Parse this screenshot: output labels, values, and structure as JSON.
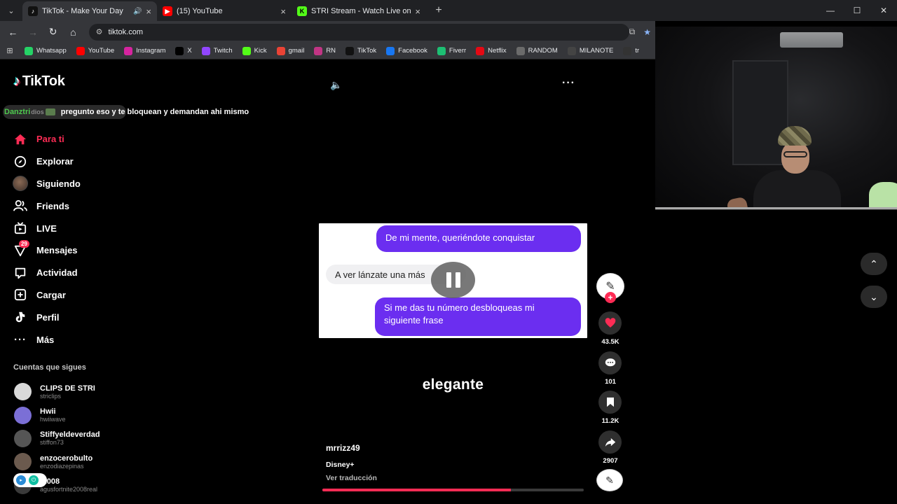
{
  "browser": {
    "tabs": [
      {
        "title": "TikTok - Make Your Day",
        "active": true,
        "favicon": "tiktok-icon",
        "audio": true
      },
      {
        "title": "(15) YouTube",
        "active": false,
        "favicon": "youtube-icon"
      },
      {
        "title": "STRI Stream - Watch Live on Ki",
        "active": false,
        "favicon": "kick-icon"
      }
    ],
    "url": "tiktok.com",
    "bookmarks": [
      {
        "label": "Whatsapp",
        "icon": "whatsapp-icon",
        "color": "#25d366"
      },
      {
        "label": "YouTube",
        "icon": "youtube-icon",
        "color": "#ff0000"
      },
      {
        "label": "Instagram",
        "icon": "instagram-icon",
        "color": "#d6249f"
      },
      {
        "label": "X",
        "icon": "x-icon",
        "color": "#000000"
      },
      {
        "label": "Twitch",
        "icon": "twitch-icon",
        "color": "#9146ff"
      },
      {
        "label": "Kick",
        "icon": "kick-icon",
        "color": "#53fc18"
      },
      {
        "label": "gmail",
        "icon": "gmail-icon",
        "color": "#ea4335"
      },
      {
        "label": "RN",
        "icon": "rn-icon",
        "color": "#c13584"
      },
      {
        "label": "TikTok",
        "icon": "tiktok-icon",
        "color": "#111111"
      },
      {
        "label": "Facebook",
        "icon": "facebook-icon",
        "color": "#1877f2"
      },
      {
        "label": "Fiverr",
        "icon": "fiverr-icon",
        "color": "#1dbf73"
      },
      {
        "label": "Netflix",
        "icon": "netflix-icon",
        "color": "#e50914"
      },
      {
        "label": "RANDOM",
        "icon": "random-icon",
        "color": "#6b6b6b"
      },
      {
        "label": "MILANOTE",
        "icon": "milanote-icon",
        "color": "#444444"
      },
      {
        "label": "tr",
        "icon": "tr-icon",
        "color": "#333333"
      }
    ]
  },
  "overlay_chat": {
    "user": "Danztri",
    "user_suffix": "dios",
    "message": "pregunto eso y te bloquean y demandan ahi mismo"
  },
  "tiktok": {
    "logo_text": "TikTok",
    "nav": [
      {
        "label": "Para ti",
        "icon": "home-icon",
        "active": true
      },
      {
        "label": "Explorar",
        "icon": "compass-icon"
      },
      {
        "label": "Siguiendo",
        "icon": "avatar"
      },
      {
        "label": "Friends",
        "icon": "friends-icon"
      },
      {
        "label": "LIVE",
        "icon": "live-icon"
      },
      {
        "label": "Mensajes",
        "icon": "messages-icon",
        "badge": "29"
      },
      {
        "label": "Actividad",
        "icon": "activity-icon"
      },
      {
        "label": "Cargar",
        "icon": "upload-icon"
      },
      {
        "label": "Perfil",
        "icon": "profile-icon"
      },
      {
        "label": "Más",
        "icon": "more-icon"
      }
    ],
    "following_title": "Cuentas que sigues",
    "following": [
      {
        "name": "CLIPS DE STRI",
        "handle": "striclips",
        "color": "#d9d9d9"
      },
      {
        "name": "Hwii",
        "handle": "hwiiwave",
        "color": "#7b6fd6"
      },
      {
        "name": "Stiffyeldeverdad",
        "handle": "stiffon73",
        "color": "#555555"
      },
      {
        "name": "enzocerobulto",
        "handle": "enzodiazepinas",
        "color": "#6b5a4e"
      },
      {
        "name": "f2008",
        "handle": "agusfortnite2008real",
        "color": "#3a3a3a"
      }
    ],
    "video": {
      "bubble_1": "De mi mente, queriéndote conquistar",
      "bubble_2": "A ver lánzate una más",
      "bubble_3": "Si me das tu número desbloqueas mi siguiente frase",
      "caption": "elegante",
      "author": "mrrizz49",
      "description": "Disney+",
      "translate": "Ver traducción",
      "progress": 0.72
    },
    "actions": {
      "likes": "43.5K",
      "comments": "101",
      "saves": "11.2K",
      "shares": "2907"
    }
  }
}
